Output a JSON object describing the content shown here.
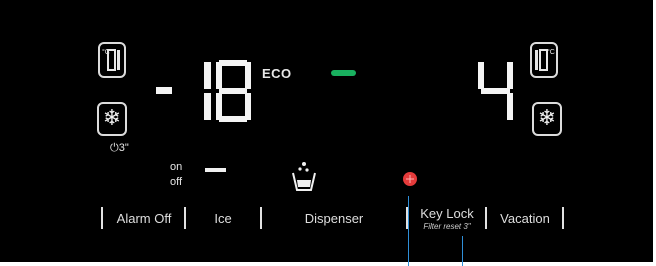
{
  "display": {
    "freezer": {
      "unit_symbol": "°C",
      "sign": "-",
      "temperature_digits": "18",
      "mode": "ECO",
      "power_freeze_hint": "3\""
    },
    "fridge": {
      "unit_symbol": "°C",
      "temperature_digits": "4"
    },
    "indicators": {
      "on_label": "on",
      "off_label": "off",
      "eco_bar_color": "#19b05f",
      "dot_color": "#e53b3b"
    }
  },
  "buttons": [
    {
      "label": "Alarm Off"
    },
    {
      "label": "Ice"
    },
    {
      "label": "Dispenser"
    },
    {
      "label": "Key Lock",
      "sublabel": "Filter reset 3\""
    },
    {
      "label": "Vacation"
    }
  ],
  "icons": {
    "freezer_compartment": "freezer-compartment-icon",
    "fridge_compartment": "fridge-compartment-icon",
    "snowflake": "snowflake-icon",
    "cup": "water-cup-icon"
  }
}
